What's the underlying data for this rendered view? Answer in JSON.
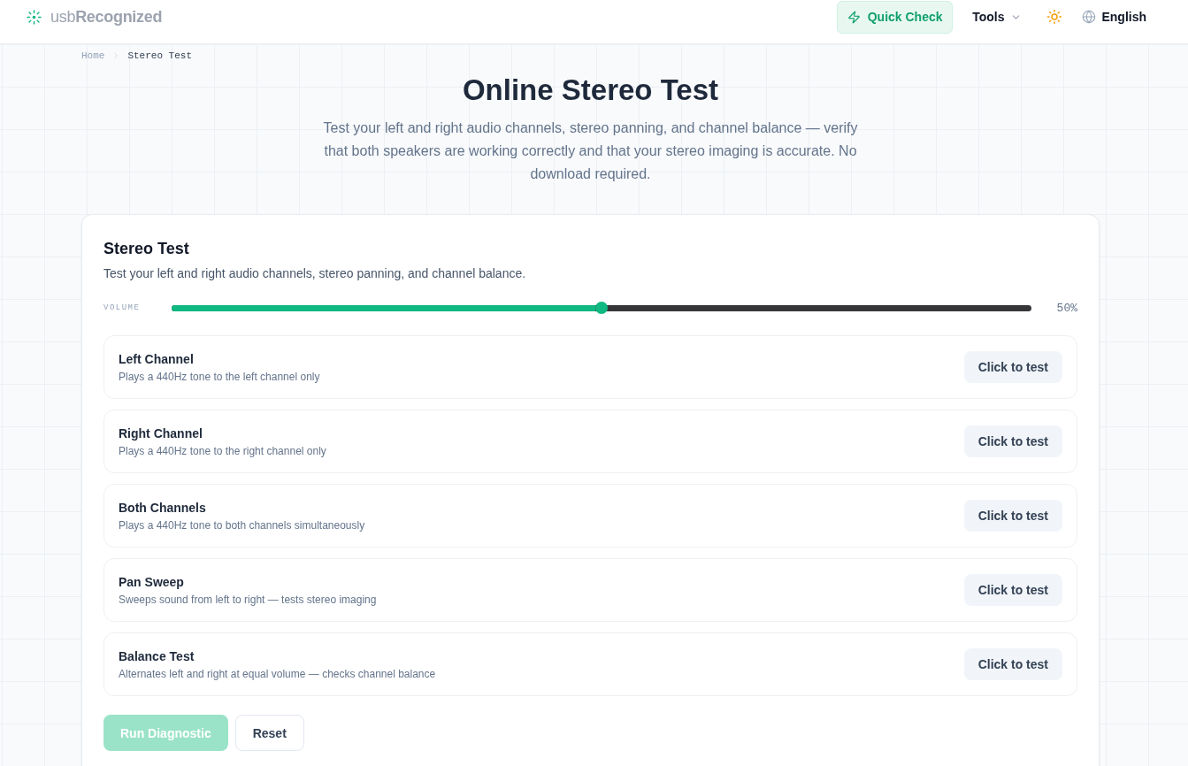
{
  "header": {
    "logo": "usb**Recognized**",
    "nav": [
      {
        "kind": "quick",
        "label": "Quick Check"
      },
      {
        "kind": "menu",
        "label": "Tools"
      },
      {
        "kind": "theme"
      },
      {
        "kind": "language",
        "label": "English"
      }
    ]
  },
  "breadcrumb": [
    {
      "label": "Home",
      "current": false
    },
    {
      "label": "Stereo Test",
      "current": true
    }
  ],
  "page": {
    "title": "Online Stereo Test",
    "subtitle": "Test your left and right audio channels, stereo panning, and channel balance — verify that both speakers are working correctly and that your stereo imaging is accurate. No download required."
  },
  "card": {
    "title": "Stereo Test",
    "description": "Test your left and right audio channels, stereo panning, and channel balance.",
    "volume": {
      "label": "VOLUME",
      "level": 0.5,
      "reading": "50%"
    },
    "tests": [
      {
        "title": "Left Channel",
        "description": "Plays a 440Hz tone to the left channel only",
        "button": "Click to test"
      },
      {
        "title": "Right Channel",
        "description": "Plays a 440Hz tone to the right channel only",
        "button": "Click to test"
      },
      {
        "title": "Both Channels",
        "description": "Plays a 440Hz tone to both channels simultaneously",
        "button": "Click to test"
      },
      {
        "title": "Pan Sweep",
        "description": "Sweeps sound from left to right — tests stereo imaging",
        "button": "Click to test"
      },
      {
        "title": "Balance Test",
        "description": "Alternates left and right at equal volume — checks channel balance",
        "button": "Click to test"
      }
    ],
    "actions": [
      {
        "kind": "primary",
        "label": "Run Diagnostic",
        "disabled": true
      },
      {
        "kind": "secondary",
        "label": "Reset",
        "disabled": false
      }
    ]
  }
}
